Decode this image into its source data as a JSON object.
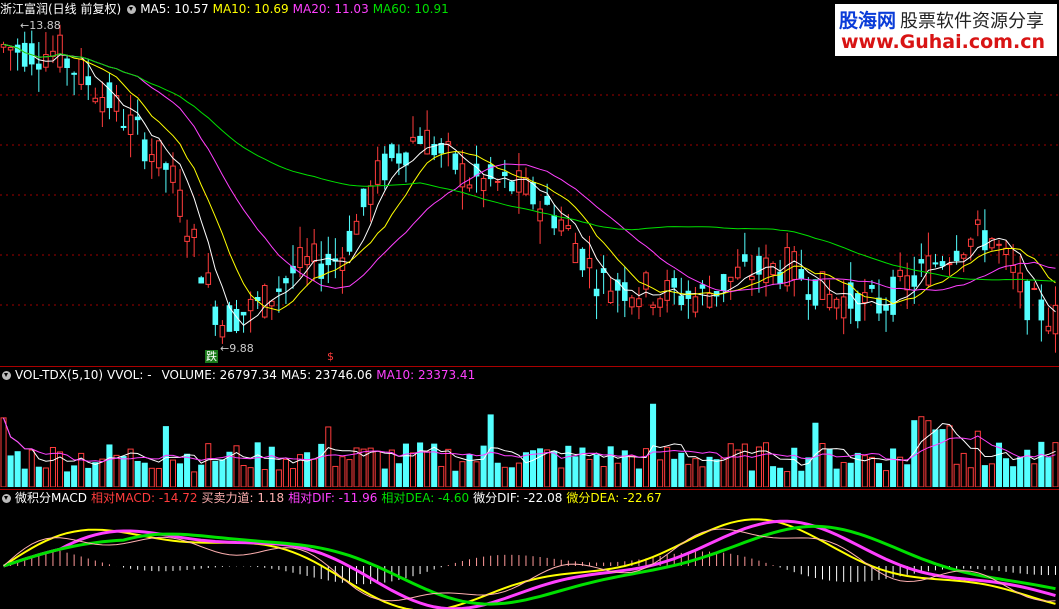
{
  "price_header": {
    "title": "浙江富润(日线 前复权)",
    "ma5": "MA5: 10.57",
    "ma10": "MA10: 10.69",
    "ma20": "MA20: 11.03",
    "ma60": "MA60: 10.91"
  },
  "price_labels": {
    "high": "13.88",
    "low": "9.88",
    "die": "跌",
    "dollar": "$"
  },
  "vol_header": {
    "name": "VOL-TDX(5,10)",
    "vvol": "VVOL: -",
    "volume": "VOLUME: 26797.34",
    "ma5": "MA5: 23746.06",
    "ma10": "MA10: 23373.41"
  },
  "macd_header": {
    "name": "微积分MACD",
    "rel_macd": "相对MACD: -14.72",
    "force": "买卖力道: 1.18",
    "rel_dif": "相对DIF: -11.96",
    "rel_dea": "相对DEA: -4.60",
    "w_dif": "微分DIF: -22.08",
    "w_dea": "微分DEA: -22.67"
  },
  "watermark": {
    "brand": "股海网",
    "slogan": "股票软件资源分享",
    "url": "www.Guhai.com.cn"
  },
  "colors": {
    "up": "#ff3c3c",
    "down": "#54ffff",
    "ma5": "#ffffff",
    "ma10": "#ffff00",
    "ma20": "#ff40ff",
    "ma60": "#00e000",
    "grid": "#a00000"
  }
}
